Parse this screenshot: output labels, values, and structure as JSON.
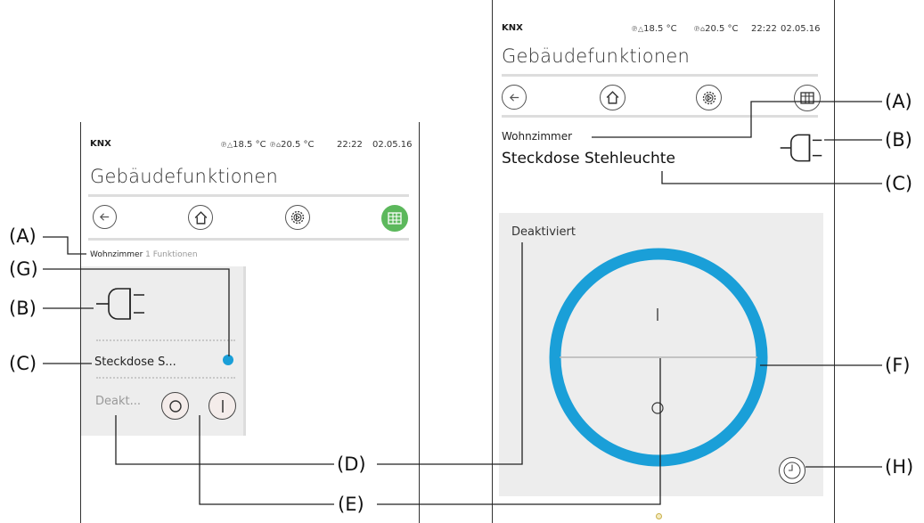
{
  "left_screen": {
    "brand": "KNX",
    "outdoor_temp": "18.5 °C",
    "indoor_temp": "20.5 °C",
    "time": "22:22",
    "date": "02.05.16",
    "title": "Gebäudefunktionen",
    "nav_icons": [
      "back-arrow-icon",
      "home-icon",
      "settings-gear-icon",
      "grid-view-icon"
    ],
    "room": "Wohnzimmer",
    "function_count": "1 Funktionen",
    "tile": {
      "name": "Steckdose S...",
      "status": "Deakt...",
      "off_symbol": "O",
      "on_symbol": "I",
      "indicator_color": "#1a9fd8"
    }
  },
  "right_screen": {
    "brand": "KNX",
    "outdoor_temp": "18.5 °C",
    "indoor_temp": "20.5 °C",
    "time": "22:22",
    "date": "02.05.16",
    "title": "Gebäudefunktionen",
    "nav_icons": [
      "back-arrow-icon",
      "home-icon",
      "settings-gear-icon",
      "grid-view-icon"
    ],
    "room": "Wohnzimmer",
    "device_name": "Steckdose Stehleuchte",
    "status": "Deaktiviert",
    "on_symbol": "I",
    "off_symbol": "O",
    "ring_color": "#1a9fd8"
  },
  "callouts": {
    "A": "(A)",
    "B": "(B)",
    "C": "(C)",
    "D": "(D)",
    "E": "(E)",
    "F": "(F)",
    "G": "(G)",
    "H": "(H)"
  },
  "colors": {
    "accent_blue": "#1a9fd8",
    "accent_green": "#5cb85c",
    "tile_bg": "#ededed"
  }
}
